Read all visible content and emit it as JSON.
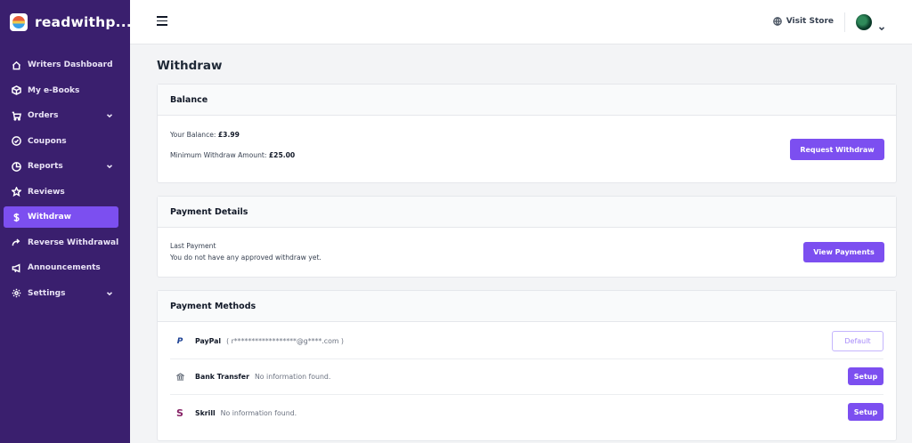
{
  "brand": {
    "name": "readwithp..."
  },
  "sidebar": {
    "items": [
      {
        "label": "Writers Dashboard",
        "icon": "home-icon"
      },
      {
        "label": "My e-Books",
        "icon": "box-icon"
      },
      {
        "label": "Orders",
        "icon": "cart-icon"
      },
      {
        "label": "Coupons",
        "icon": "coupon-icon"
      },
      {
        "label": "Reports",
        "icon": "chart-pie-icon"
      },
      {
        "label": "Reviews",
        "icon": "star-icon"
      },
      {
        "label": "Withdraw",
        "icon": "dollar-icon",
        "active": true
      },
      {
        "label": "Reverse Withdrawal",
        "icon": "redo-icon"
      },
      {
        "label": "Announcements",
        "icon": "megaphone-icon"
      },
      {
        "label": "Settings",
        "icon": "gear-icon"
      }
    ]
  },
  "topbar": {
    "visit_store": "Visit Store"
  },
  "page": {
    "title": "Withdraw"
  },
  "balance": {
    "title": "Balance",
    "your_balance_label": "Your Balance:",
    "your_balance_value": "£3.99",
    "min_label": "Minimum Withdraw Amount:",
    "min_value": "£25.00",
    "button": "Request Withdraw"
  },
  "payment_details": {
    "title": "Payment Details",
    "last_payment": "Last Payment",
    "message": "You do not have any approved withdraw yet.",
    "button": "View Payments"
  },
  "payment_methods": {
    "title": "Payment Methods",
    "rows": [
      {
        "name": "PayPal",
        "detail": "( r******************@g****.com )",
        "button": "Default",
        "icon": "paypal-icon"
      },
      {
        "name": "Bank Transfer",
        "detail": "No information found.",
        "button": "Setup",
        "icon": "bank-icon"
      },
      {
        "name": "Skrill",
        "detail": "No information found.",
        "button": "Setup",
        "icon": "skrill-icon"
      }
    ]
  },
  "colors": {
    "sidebar": "#3a1f6e",
    "accent": "#7c4ff0"
  }
}
